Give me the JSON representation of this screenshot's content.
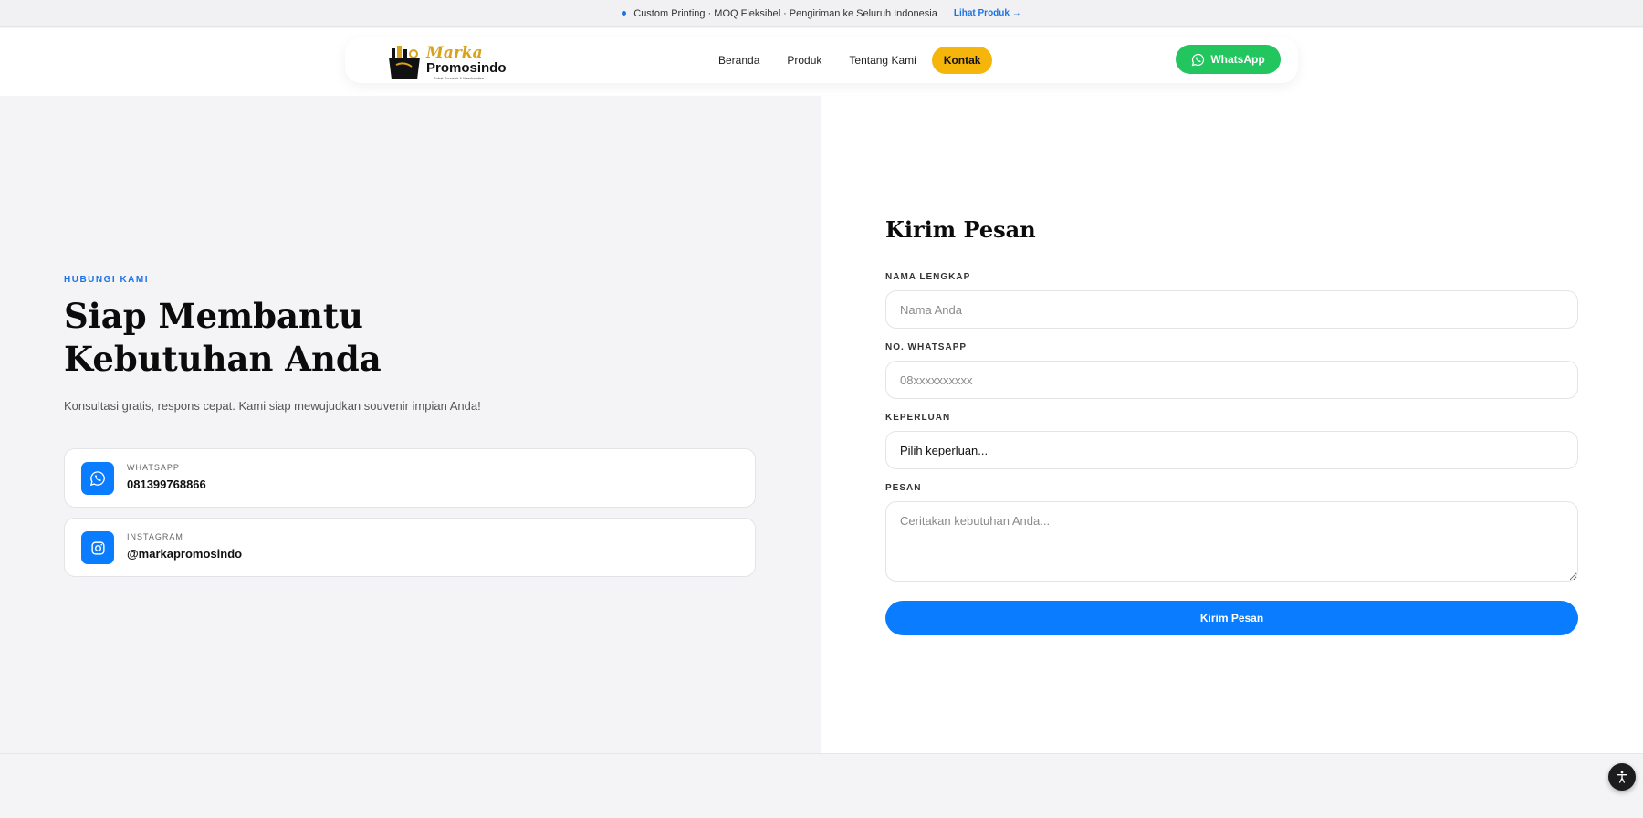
{
  "announcement": {
    "text": "Custom Printing · MOQ Fleksibel · Pengiriman ke Seluruh Indonesia",
    "link_label": "Lihat Produk →"
  },
  "header": {
    "logo": {
      "line1": "Marka",
      "line2": "Promosindo",
      "tagline": "Sobat Souvenir & Merchandise"
    },
    "nav": [
      {
        "label": "Beranda"
      },
      {
        "label": "Produk"
      },
      {
        "label": "Tentang Kami"
      },
      {
        "label": "Kontak",
        "active": true
      }
    ],
    "cta_label": "WhatsApp"
  },
  "hero": {
    "eyebrow": "HUBUNGI KAMI",
    "title_line1": "Siap Membantu",
    "title_line2": "Kebutuhan Anda",
    "subtitle": "Konsultasi gratis, respons cepat. Kami siap mewujudkan souvenir impian Anda!"
  },
  "contacts": [
    {
      "label": "WHATSAPP",
      "value": "081399768866",
      "icon": "whatsapp-icon"
    },
    {
      "label": "INSTAGRAM",
      "value": "@markapromosindo",
      "icon": "instagram-icon"
    }
  ],
  "form": {
    "title": "Kirim Pesan",
    "name_label": "NAMA LENGKAP",
    "name_placeholder": "Nama Anda",
    "phone_label": "NO. WHATSAPP",
    "phone_placeholder": "08xxxxxxxxxx",
    "purpose_label": "KEPERLUAN",
    "purpose_value": "Pilih keperluan...",
    "message_label": "PESAN",
    "message_placeholder": "Ceritakan kebutuhan Anda...",
    "submit_label": "Kirim Pesan"
  },
  "colors": {
    "accent": "#0a7cff",
    "whatsapp": "#22c55e",
    "active_nav": "#f5b50a"
  }
}
